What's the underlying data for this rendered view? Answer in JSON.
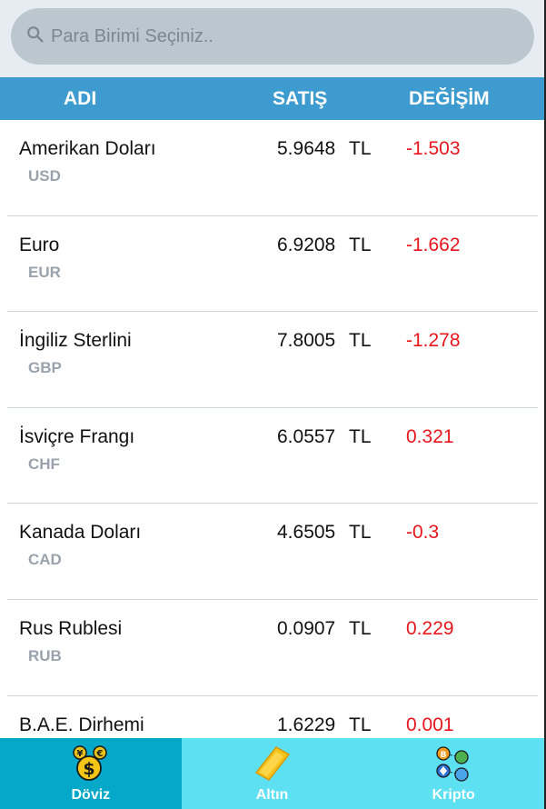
{
  "search": {
    "placeholder": "Para Birimi Seçiniz.."
  },
  "header": {
    "name_col": "ADI",
    "sell_col": "SATIŞ",
    "change_col": "DEĞİŞİM"
  },
  "rows": [
    {
      "name": "Amerikan Doları",
      "code": "USD",
      "sell": "5.9648",
      "unit": "TL",
      "change": "-1.503"
    },
    {
      "name": "Euro",
      "code": "EUR",
      "sell": "6.9208",
      "unit": "TL",
      "change": "-1.662"
    },
    {
      "name": "İngiliz Sterlini",
      "code": "GBP",
      "sell": "7.8005",
      "unit": "TL",
      "change": "-1.278"
    },
    {
      "name": "İsviçre Frangı",
      "code": "CHF",
      "sell": "6.0557",
      "unit": "TL",
      "change": "0.321"
    },
    {
      "name": "Kanada Doları",
      "code": "CAD",
      "sell": "4.6505",
      "unit": "TL",
      "change": "-0.3"
    },
    {
      "name": "Rus Rublesi",
      "code": "RUB",
      "sell": "0.0907",
      "unit": "TL",
      "change": "0.229"
    },
    {
      "name": "B.A.E. Dirhemi",
      "code": "",
      "sell": "1.6229",
      "unit": "TL",
      "change": "0.001"
    }
  ],
  "tabs": [
    {
      "label": "Döviz",
      "icon": "coins-dollar-icon",
      "active": true
    },
    {
      "label": "Altın",
      "icon": "gold-bar-icon",
      "active": false
    },
    {
      "label": "Kripto",
      "icon": "crypto-coins-icon",
      "active": false
    }
  ],
  "colors": {
    "header_bg": "#3e9bd0",
    "change_color": "#e8161c",
    "tab_active": "#05a8c8",
    "tab_inactive": "#5ee0f3"
  }
}
